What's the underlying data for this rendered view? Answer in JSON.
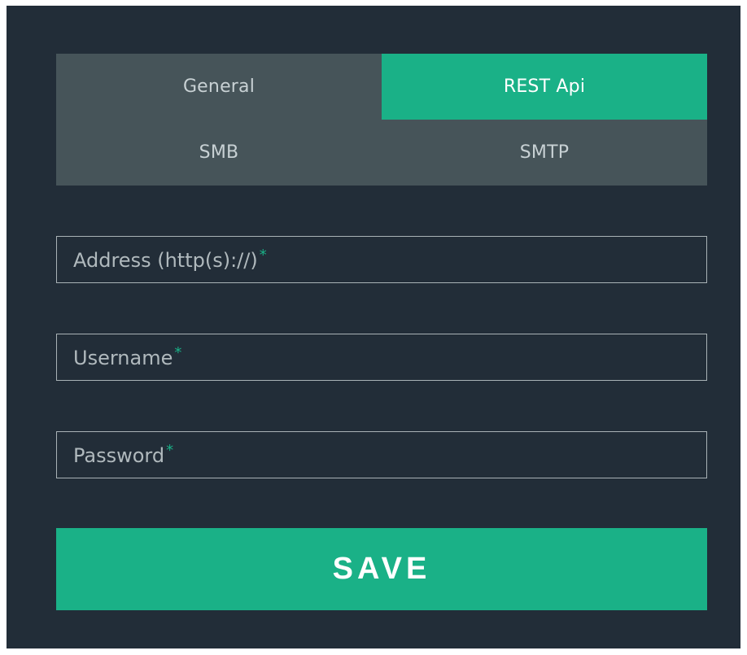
{
  "tabs": [
    {
      "label": "General",
      "active": false
    },
    {
      "label": "REST Api",
      "active": true
    },
    {
      "label": "SMB",
      "active": false
    },
    {
      "label": "SMTP",
      "active": false
    }
  ],
  "form": {
    "address": {
      "placeholder": "Address (http(s)://)",
      "required_marker": "*",
      "value": ""
    },
    "username": {
      "placeholder": "Username",
      "required_marker": "*",
      "value": ""
    },
    "password": {
      "placeholder": "Password",
      "required_marker": "*",
      "value": ""
    }
  },
  "save_label": "SAVE",
  "colors": {
    "background": "#222d38",
    "accent": "#1ab187",
    "tab_inactive": "#465459",
    "field_border": "#a9b2b6"
  }
}
